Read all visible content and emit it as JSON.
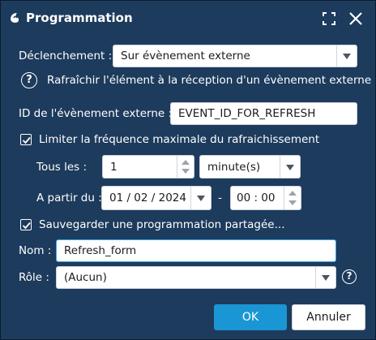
{
  "window": {
    "title": "Programmation",
    "maximize_icon": "maximize-icon",
    "close_icon": "close-icon"
  },
  "trigger": {
    "label": "Déclenchement :",
    "value": "Sur évènement externe"
  },
  "help_text": "Rafraîchir l'élément à la réception d'un évènement externe",
  "event_id": {
    "label": "ID de l'évènement externe :",
    "value": "EVENT_ID_FOR_REFRESH"
  },
  "limit_frequency": {
    "label": "Limiter la fréquence maximale du rafraichissement",
    "checked": true
  },
  "every": {
    "label": "Tous les :",
    "value": "1",
    "unit": "minute(s)"
  },
  "start": {
    "label": "A partir du :",
    "date": "01 / 02 / 2024",
    "separator": "-",
    "time": "00 : 00"
  },
  "save_shared": {
    "label": "Sauvegarder une programmation partagée...",
    "checked": true
  },
  "name": {
    "label": "Nom :",
    "value": "Refresh_form"
  },
  "role": {
    "label": "Rôle :",
    "value": "(Aucun)"
  },
  "buttons": {
    "ok": "OK",
    "cancel": "Annuler"
  },
  "colors": {
    "background": "#1d3b5c",
    "accent": "#1a96d4",
    "field": "#ffffff"
  }
}
